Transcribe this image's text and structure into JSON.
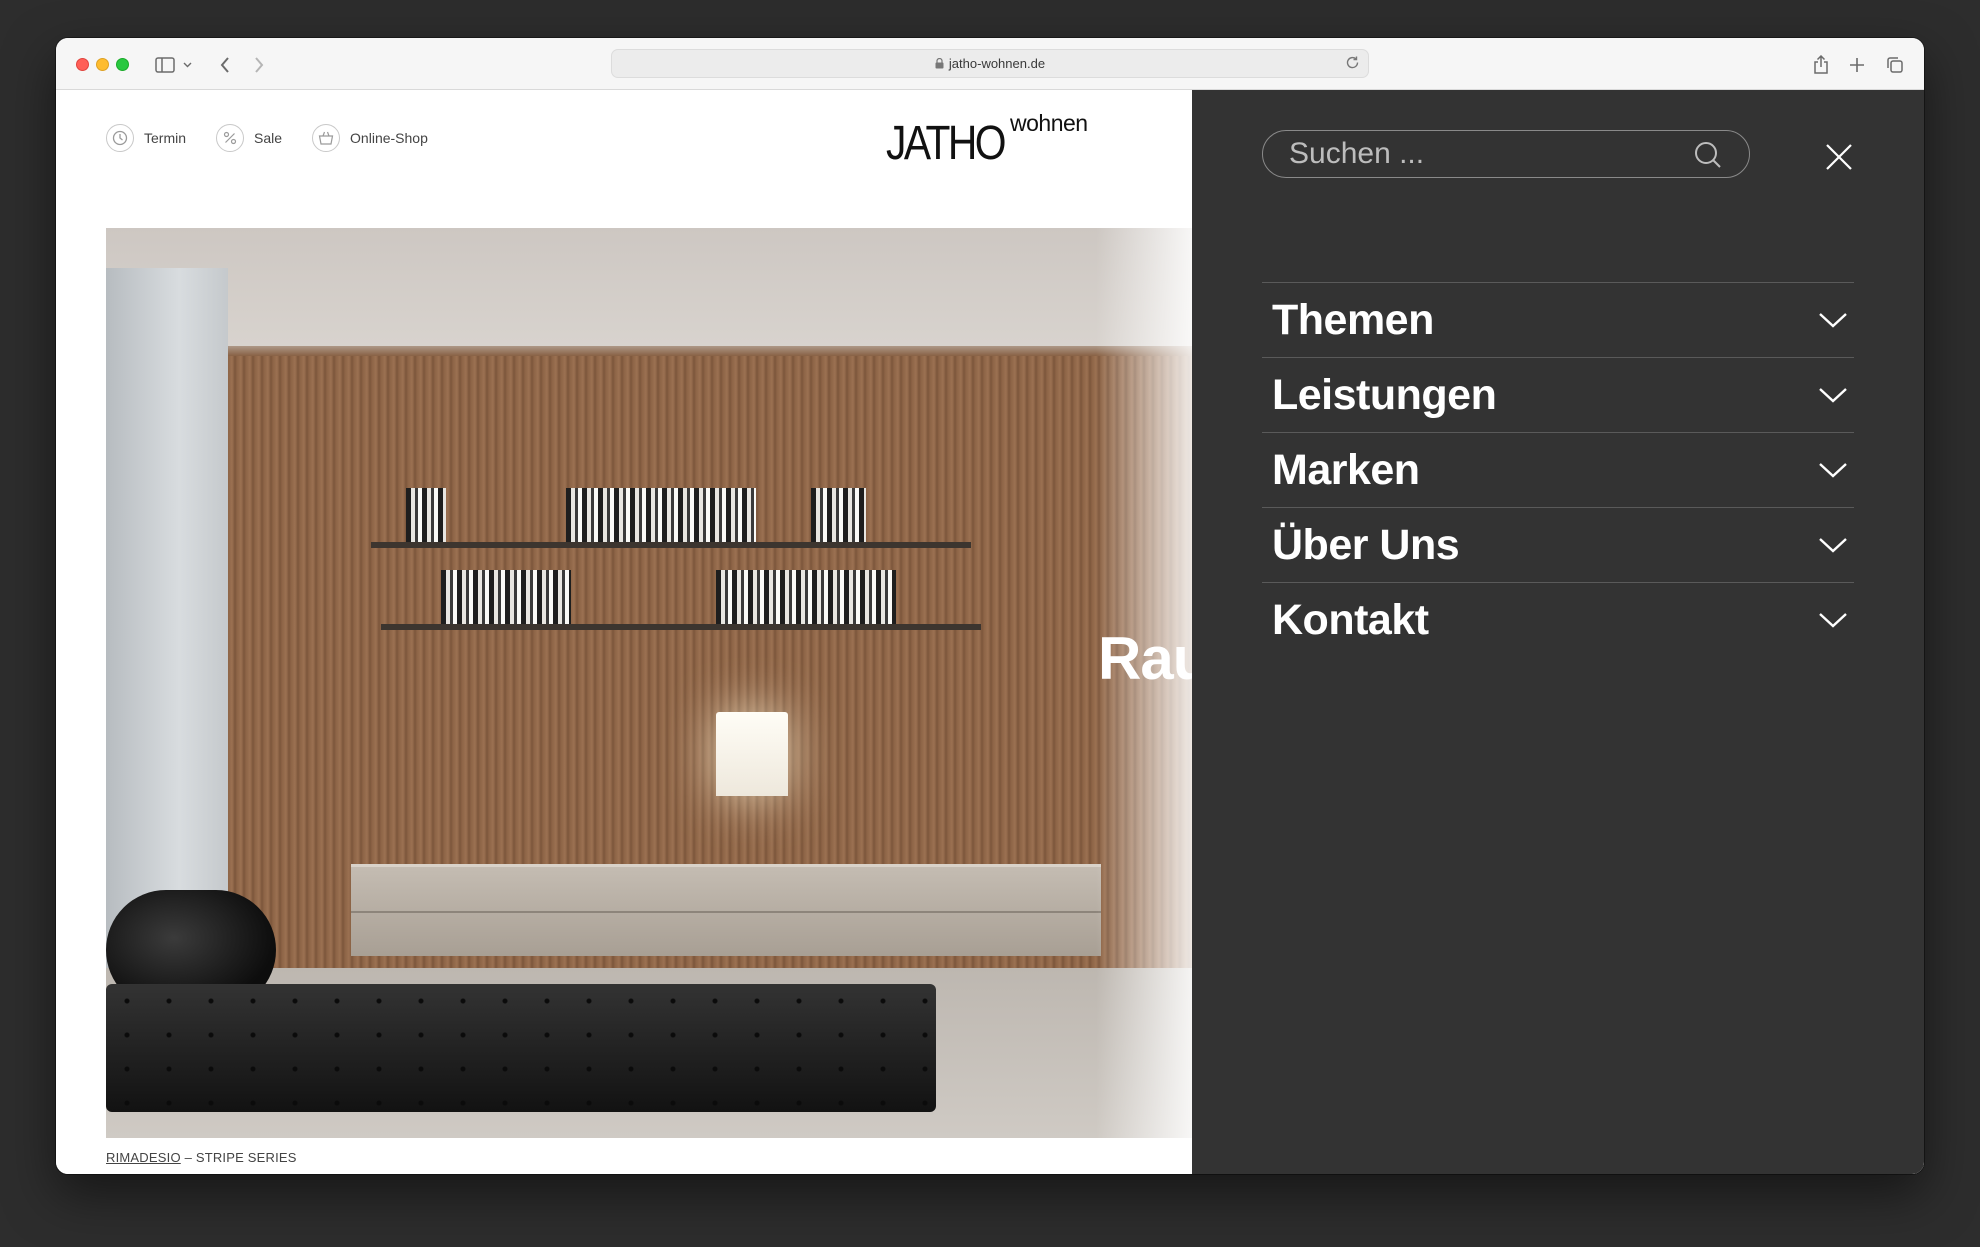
{
  "browser": {
    "url": "jatho-wohnen.de"
  },
  "header": {
    "nav": [
      {
        "label": "Termin",
        "icon": "clock-icon"
      },
      {
        "label": "Sale",
        "icon": "percent-icon"
      },
      {
        "label": "Online-Shop",
        "icon": "basket-icon"
      }
    ],
    "logo_main": "JATHO",
    "logo_sub": "wohnen"
  },
  "hero": {
    "overlay_text": "Rau",
    "caption_brand": "RIMADESIO",
    "caption_rest": " – STRIPE SERIES"
  },
  "menu": {
    "search_placeholder": "Suchen ...",
    "items": [
      {
        "label": "Themen"
      },
      {
        "label": "Leistungen"
      },
      {
        "label": "Marken"
      },
      {
        "label": "Über Uns"
      },
      {
        "label": "Kontakt"
      }
    ]
  },
  "colors": {
    "menu_bg": "#333333",
    "desktop_bg": "#2d2d2d"
  }
}
